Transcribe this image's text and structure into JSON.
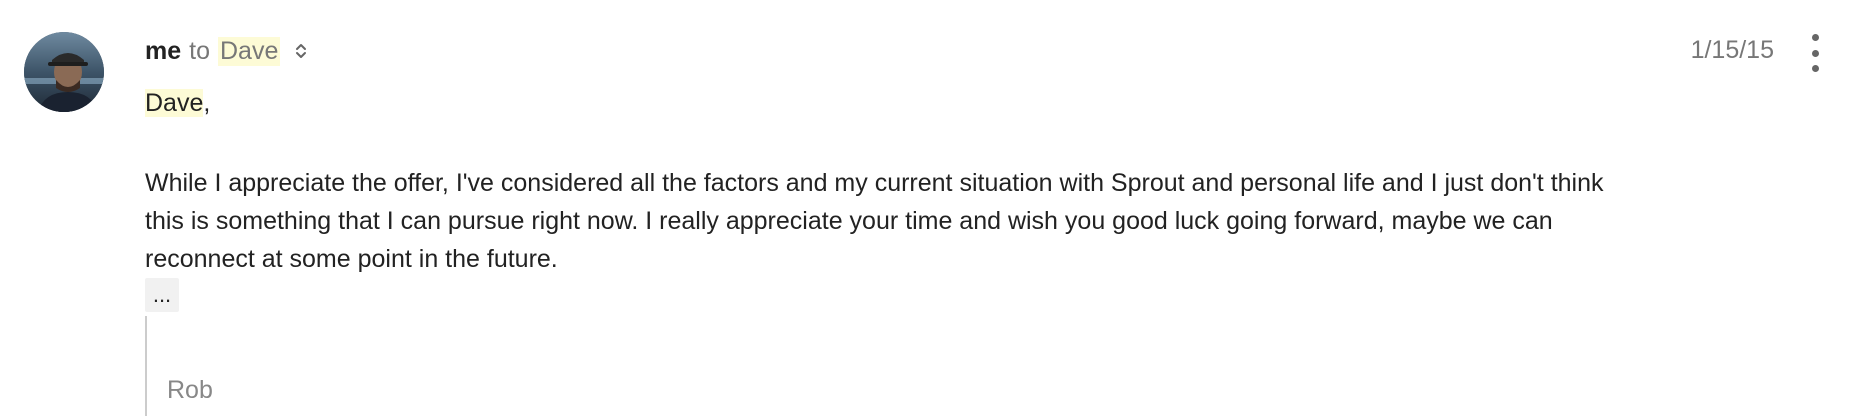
{
  "message": {
    "sender": "me",
    "to_word": "to",
    "recipient": "Dave",
    "date": "1/15/15",
    "greeting_name": "Dave",
    "greeting_punct": ",",
    "body": "While I appreciate the offer, I've considered all the factors and my current situation with Sprout and personal life and I just don't think\nthis is something that I can pursue right now.  I really appreciate your time and wish you good luck going forward, maybe we can\nreconnect at some point in the future.",
    "show_trimmed_label": "...",
    "quoted_signature": "Rob"
  },
  "icons": {
    "avatar": "avatar-photo",
    "expand": "chevron-updown-icon",
    "more": "more-vertical-icon"
  },
  "colors": {
    "highlight": "#fdfbd6",
    "muted_text": "#777777",
    "body_text": "#222222"
  }
}
